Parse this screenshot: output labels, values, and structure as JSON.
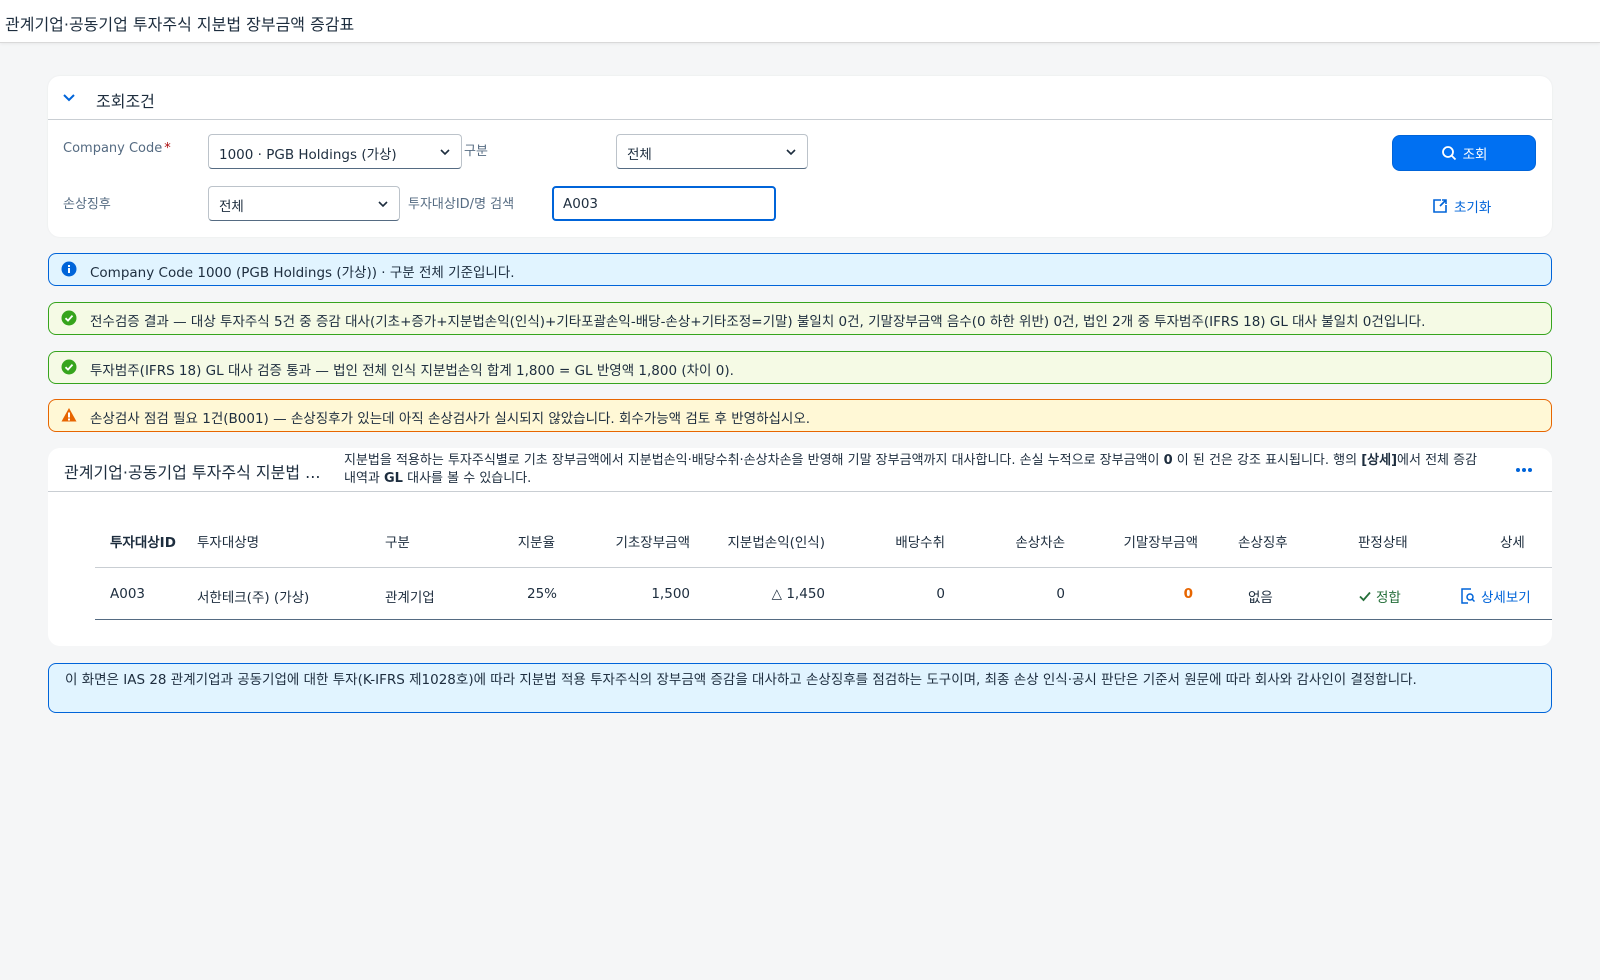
{
  "shell": {
    "title": "관계기업·공동기업 투자주식 지분법 장부금액 증감표"
  },
  "filters": {
    "header": "조회조건",
    "company_code_label": "Company Code",
    "company_code_required": "*",
    "company_code_value": "1000 · PGB Holdings (가상)",
    "type_label": "구분",
    "type_value": "전체",
    "impairment_label": "손상징후",
    "impairment_value": "전체",
    "search_label": "투자대상ID/명 검색",
    "search_value": "A003",
    "search_button": "조회",
    "reset_button": "초기화"
  },
  "messages": {
    "info": "Company Code 1000 (PGB Holdings (가상)) · 구분 전체 기준입니다.",
    "success1": "전수검증 결과 — 대상 투자주식 5건 중 증감 대사(기초+증가+지분법손익(인식)+기타포괄손익-배당-손상+기타조정=기말) 불일치 0건, 기말장부금액 음수(0 하한 위반) 0건, 법인 2개 중 투자범주(IFRS 18) GL 대사 불일치 0건입니다.",
    "success2": "투자범주(IFRS 18) GL 대사 검증 통과 — 법인 전체 인식 지분법손익 합계 1,800 = GL 반영액 1,800 (차이 0).",
    "warning": "손상검사 점검 필요 1건(B001) — 손상징후가 있는데 아직 손상검사가 실시되지 않았습니다. 회수가능액 검토 후 반영하십시오."
  },
  "table": {
    "title": "관계기업·공동기업 투자주식 지분법 ...",
    "desc_part1": "지분법을 적용하는 투자주식별로 기초 장부금액에서 지분법손익·배당수취·손상차손을 반영해 기말 장부금액까지 대사합니다. 손실 누적으로 장부금액이 ",
    "desc_bold1": "0",
    "desc_part2": " 이 된 건은 강조 표시됩니다. 행의 ",
    "desc_bold2": "[상세]",
    "desc_part3": "에서 전체 증감 내역과 ",
    "desc_bold3": "GL",
    "desc_part4": " 대사를 볼 수 있습니다.",
    "columns": {
      "id": "투자대상ID",
      "name": "투자대상명",
      "type": "구분",
      "share": "지분율",
      "opening": "기초장부금액",
      "equity_pl": "지분법손익(인식)",
      "dividend": "배당수취",
      "impairment": "손상차손",
      "closing": "기말장부금액",
      "indicator": "손상징후",
      "status": "판정상태",
      "detail": "상세"
    },
    "rows": [
      {
        "id": "A003",
        "name": "서한테크(주) (가상)",
        "type": "관계기업",
        "share": "25%",
        "opening": "1,500",
        "equity_pl": "△ 1,450",
        "dividend": "0",
        "impairment": "0",
        "closing": "0",
        "indicator": "없음",
        "status": "정합",
        "detail": "상세보기"
      }
    ]
  },
  "footer": {
    "note": "이 화면은 IAS 28 관계기업과 공동기업에 대한 투자(K-IFRS 제1028호)에 따라 지분법 적용 투자주식의 장부금액 증감을 대사하고 손상징후를 점검하는 도구이며, 최종 손상 인식·공시 판단은 기준서 원문에 따라 회사와 감사인이 결정합니다."
  },
  "colors": {
    "brand": "#0070f2",
    "info_bg": "#e1f4ff",
    "success_bg": "#f5fae5",
    "warning_bg": "#fff8d6",
    "warning_accent": "#e76500",
    "success_accent": "#36a41d"
  },
  "icons": [
    "chevron-down-icon",
    "search-icon",
    "reset-icon",
    "info-icon",
    "success-icon",
    "warning-icon",
    "more-icon",
    "check-icon",
    "detail-icon"
  ]
}
